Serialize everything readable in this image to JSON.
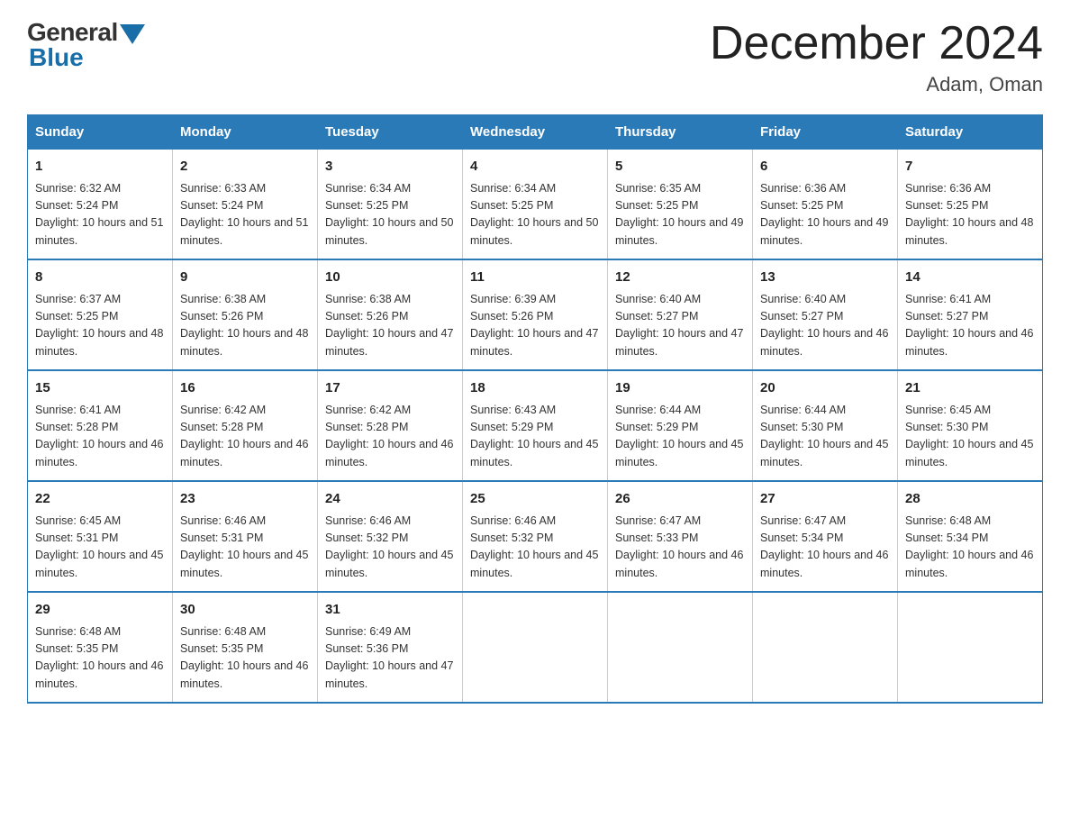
{
  "logo": {
    "general": "General",
    "blue": "Blue"
  },
  "title": "December 2024",
  "location": "Adam, Oman",
  "days_header": [
    "Sunday",
    "Monday",
    "Tuesday",
    "Wednesday",
    "Thursday",
    "Friday",
    "Saturday"
  ],
  "weeks": [
    [
      {
        "num": "1",
        "sunrise": "6:32 AM",
        "sunset": "5:24 PM",
        "daylight": "10 hours and 51 minutes."
      },
      {
        "num": "2",
        "sunrise": "6:33 AM",
        "sunset": "5:24 PM",
        "daylight": "10 hours and 51 minutes."
      },
      {
        "num": "3",
        "sunrise": "6:34 AM",
        "sunset": "5:25 PM",
        "daylight": "10 hours and 50 minutes."
      },
      {
        "num": "4",
        "sunrise": "6:34 AM",
        "sunset": "5:25 PM",
        "daylight": "10 hours and 50 minutes."
      },
      {
        "num": "5",
        "sunrise": "6:35 AM",
        "sunset": "5:25 PM",
        "daylight": "10 hours and 49 minutes."
      },
      {
        "num": "6",
        "sunrise": "6:36 AM",
        "sunset": "5:25 PM",
        "daylight": "10 hours and 49 minutes."
      },
      {
        "num": "7",
        "sunrise": "6:36 AM",
        "sunset": "5:25 PM",
        "daylight": "10 hours and 48 minutes."
      }
    ],
    [
      {
        "num": "8",
        "sunrise": "6:37 AM",
        "sunset": "5:25 PM",
        "daylight": "10 hours and 48 minutes."
      },
      {
        "num": "9",
        "sunrise": "6:38 AM",
        "sunset": "5:26 PM",
        "daylight": "10 hours and 48 minutes."
      },
      {
        "num": "10",
        "sunrise": "6:38 AM",
        "sunset": "5:26 PM",
        "daylight": "10 hours and 47 minutes."
      },
      {
        "num": "11",
        "sunrise": "6:39 AM",
        "sunset": "5:26 PM",
        "daylight": "10 hours and 47 minutes."
      },
      {
        "num": "12",
        "sunrise": "6:40 AM",
        "sunset": "5:27 PM",
        "daylight": "10 hours and 47 minutes."
      },
      {
        "num": "13",
        "sunrise": "6:40 AM",
        "sunset": "5:27 PM",
        "daylight": "10 hours and 46 minutes."
      },
      {
        "num": "14",
        "sunrise": "6:41 AM",
        "sunset": "5:27 PM",
        "daylight": "10 hours and 46 minutes."
      }
    ],
    [
      {
        "num": "15",
        "sunrise": "6:41 AM",
        "sunset": "5:28 PM",
        "daylight": "10 hours and 46 minutes."
      },
      {
        "num": "16",
        "sunrise": "6:42 AM",
        "sunset": "5:28 PM",
        "daylight": "10 hours and 46 minutes."
      },
      {
        "num": "17",
        "sunrise": "6:42 AM",
        "sunset": "5:28 PM",
        "daylight": "10 hours and 46 minutes."
      },
      {
        "num": "18",
        "sunrise": "6:43 AM",
        "sunset": "5:29 PM",
        "daylight": "10 hours and 45 minutes."
      },
      {
        "num": "19",
        "sunrise": "6:44 AM",
        "sunset": "5:29 PM",
        "daylight": "10 hours and 45 minutes."
      },
      {
        "num": "20",
        "sunrise": "6:44 AM",
        "sunset": "5:30 PM",
        "daylight": "10 hours and 45 minutes."
      },
      {
        "num": "21",
        "sunrise": "6:45 AM",
        "sunset": "5:30 PM",
        "daylight": "10 hours and 45 minutes."
      }
    ],
    [
      {
        "num": "22",
        "sunrise": "6:45 AM",
        "sunset": "5:31 PM",
        "daylight": "10 hours and 45 minutes."
      },
      {
        "num": "23",
        "sunrise": "6:46 AM",
        "sunset": "5:31 PM",
        "daylight": "10 hours and 45 minutes."
      },
      {
        "num": "24",
        "sunrise": "6:46 AM",
        "sunset": "5:32 PM",
        "daylight": "10 hours and 45 minutes."
      },
      {
        "num": "25",
        "sunrise": "6:46 AM",
        "sunset": "5:32 PM",
        "daylight": "10 hours and 45 minutes."
      },
      {
        "num": "26",
        "sunrise": "6:47 AM",
        "sunset": "5:33 PM",
        "daylight": "10 hours and 46 minutes."
      },
      {
        "num": "27",
        "sunrise": "6:47 AM",
        "sunset": "5:34 PM",
        "daylight": "10 hours and 46 minutes."
      },
      {
        "num": "28",
        "sunrise": "6:48 AM",
        "sunset": "5:34 PM",
        "daylight": "10 hours and 46 minutes."
      }
    ],
    [
      {
        "num": "29",
        "sunrise": "6:48 AM",
        "sunset": "5:35 PM",
        "daylight": "10 hours and 46 minutes."
      },
      {
        "num": "30",
        "sunrise": "6:48 AM",
        "sunset": "5:35 PM",
        "daylight": "10 hours and 46 minutes."
      },
      {
        "num": "31",
        "sunrise": "6:49 AM",
        "sunset": "5:36 PM",
        "daylight": "10 hours and 47 minutes."
      },
      {
        "num": "",
        "sunrise": "",
        "sunset": "",
        "daylight": ""
      },
      {
        "num": "",
        "sunrise": "",
        "sunset": "",
        "daylight": ""
      },
      {
        "num": "",
        "sunrise": "",
        "sunset": "",
        "daylight": ""
      },
      {
        "num": "",
        "sunrise": "",
        "sunset": "",
        "daylight": ""
      }
    ]
  ]
}
